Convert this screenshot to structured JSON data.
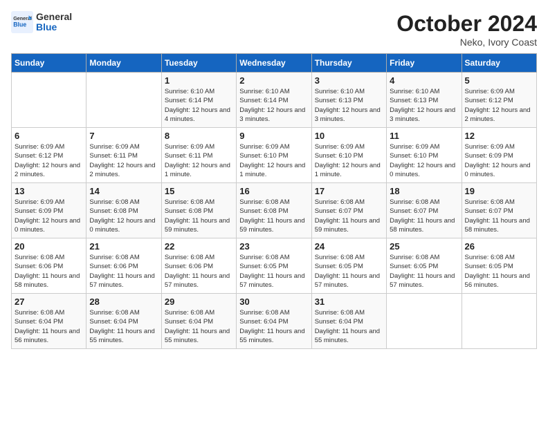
{
  "logo": {
    "general": "General",
    "blue": "Blue"
  },
  "title": {
    "month_year": "October 2024",
    "location": "Neko, Ivory Coast"
  },
  "days_of_week": [
    "Sunday",
    "Monday",
    "Tuesday",
    "Wednesday",
    "Thursday",
    "Friday",
    "Saturday"
  ],
  "weeks": [
    [
      {
        "day": "",
        "detail": ""
      },
      {
        "day": "",
        "detail": ""
      },
      {
        "day": "1",
        "detail": "Sunrise: 6:10 AM\nSunset: 6:14 PM\nDaylight: 12 hours and 4 minutes."
      },
      {
        "day": "2",
        "detail": "Sunrise: 6:10 AM\nSunset: 6:14 PM\nDaylight: 12 hours and 3 minutes."
      },
      {
        "day": "3",
        "detail": "Sunrise: 6:10 AM\nSunset: 6:13 PM\nDaylight: 12 hours and 3 minutes."
      },
      {
        "day": "4",
        "detail": "Sunrise: 6:10 AM\nSunset: 6:13 PM\nDaylight: 12 hours and 3 minutes."
      },
      {
        "day": "5",
        "detail": "Sunrise: 6:09 AM\nSunset: 6:12 PM\nDaylight: 12 hours and 2 minutes."
      }
    ],
    [
      {
        "day": "6",
        "detail": "Sunrise: 6:09 AM\nSunset: 6:12 PM\nDaylight: 12 hours and 2 minutes."
      },
      {
        "day": "7",
        "detail": "Sunrise: 6:09 AM\nSunset: 6:11 PM\nDaylight: 12 hours and 2 minutes."
      },
      {
        "day": "8",
        "detail": "Sunrise: 6:09 AM\nSunset: 6:11 PM\nDaylight: 12 hours and 1 minute."
      },
      {
        "day": "9",
        "detail": "Sunrise: 6:09 AM\nSunset: 6:10 PM\nDaylight: 12 hours and 1 minute."
      },
      {
        "day": "10",
        "detail": "Sunrise: 6:09 AM\nSunset: 6:10 PM\nDaylight: 12 hours and 1 minute."
      },
      {
        "day": "11",
        "detail": "Sunrise: 6:09 AM\nSunset: 6:10 PM\nDaylight: 12 hours and 0 minutes."
      },
      {
        "day": "12",
        "detail": "Sunrise: 6:09 AM\nSunset: 6:09 PM\nDaylight: 12 hours and 0 minutes."
      }
    ],
    [
      {
        "day": "13",
        "detail": "Sunrise: 6:09 AM\nSunset: 6:09 PM\nDaylight: 12 hours and 0 minutes."
      },
      {
        "day": "14",
        "detail": "Sunrise: 6:08 AM\nSunset: 6:08 PM\nDaylight: 12 hours and 0 minutes."
      },
      {
        "day": "15",
        "detail": "Sunrise: 6:08 AM\nSunset: 6:08 PM\nDaylight: 11 hours and 59 minutes."
      },
      {
        "day": "16",
        "detail": "Sunrise: 6:08 AM\nSunset: 6:08 PM\nDaylight: 11 hours and 59 minutes."
      },
      {
        "day": "17",
        "detail": "Sunrise: 6:08 AM\nSunset: 6:07 PM\nDaylight: 11 hours and 59 minutes."
      },
      {
        "day": "18",
        "detail": "Sunrise: 6:08 AM\nSunset: 6:07 PM\nDaylight: 11 hours and 58 minutes."
      },
      {
        "day": "19",
        "detail": "Sunrise: 6:08 AM\nSunset: 6:07 PM\nDaylight: 11 hours and 58 minutes."
      }
    ],
    [
      {
        "day": "20",
        "detail": "Sunrise: 6:08 AM\nSunset: 6:06 PM\nDaylight: 11 hours and 58 minutes."
      },
      {
        "day": "21",
        "detail": "Sunrise: 6:08 AM\nSunset: 6:06 PM\nDaylight: 11 hours and 57 minutes."
      },
      {
        "day": "22",
        "detail": "Sunrise: 6:08 AM\nSunset: 6:06 PM\nDaylight: 11 hours and 57 minutes."
      },
      {
        "day": "23",
        "detail": "Sunrise: 6:08 AM\nSunset: 6:05 PM\nDaylight: 11 hours and 57 minutes."
      },
      {
        "day": "24",
        "detail": "Sunrise: 6:08 AM\nSunset: 6:05 PM\nDaylight: 11 hours and 57 minutes."
      },
      {
        "day": "25",
        "detail": "Sunrise: 6:08 AM\nSunset: 6:05 PM\nDaylight: 11 hours and 57 minutes."
      },
      {
        "day": "26",
        "detail": "Sunrise: 6:08 AM\nSunset: 6:05 PM\nDaylight: 11 hours and 56 minutes."
      }
    ],
    [
      {
        "day": "27",
        "detail": "Sunrise: 6:08 AM\nSunset: 6:04 PM\nDaylight: 11 hours and 56 minutes."
      },
      {
        "day": "28",
        "detail": "Sunrise: 6:08 AM\nSunset: 6:04 PM\nDaylight: 11 hours and 55 minutes."
      },
      {
        "day": "29",
        "detail": "Sunrise: 6:08 AM\nSunset: 6:04 PM\nDaylight: 11 hours and 55 minutes."
      },
      {
        "day": "30",
        "detail": "Sunrise: 6:08 AM\nSunset: 6:04 PM\nDaylight: 11 hours and 55 minutes."
      },
      {
        "day": "31",
        "detail": "Sunrise: 6:08 AM\nSunset: 6:04 PM\nDaylight: 11 hours and 55 minutes."
      },
      {
        "day": "",
        "detail": ""
      },
      {
        "day": "",
        "detail": ""
      }
    ]
  ]
}
